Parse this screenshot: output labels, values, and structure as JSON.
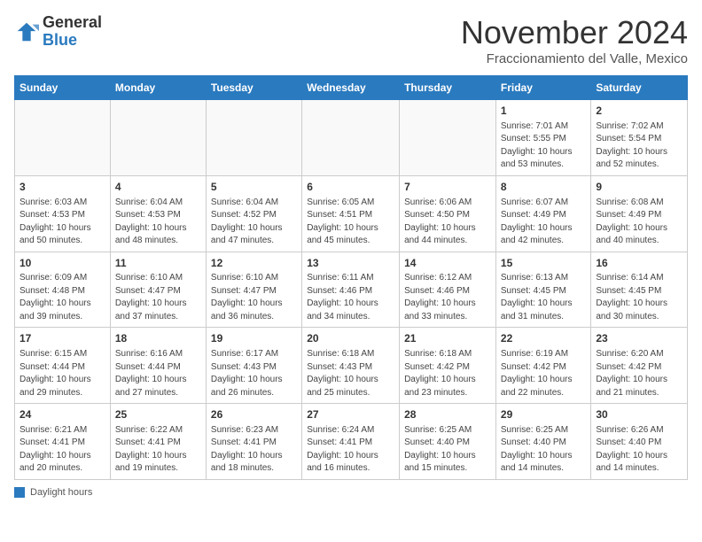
{
  "header": {
    "logo_general": "General",
    "logo_blue": "Blue",
    "month_title": "November 2024",
    "location": "Fraccionamiento del Valle, Mexico"
  },
  "days_of_week": [
    "Sunday",
    "Monday",
    "Tuesday",
    "Wednesday",
    "Thursday",
    "Friday",
    "Saturday"
  ],
  "weeks": [
    [
      {
        "day": "",
        "info": ""
      },
      {
        "day": "",
        "info": ""
      },
      {
        "day": "",
        "info": ""
      },
      {
        "day": "",
        "info": ""
      },
      {
        "day": "",
        "info": ""
      },
      {
        "day": "1",
        "info": "Sunrise: 7:01 AM\nSunset: 5:55 PM\nDaylight: 10 hours\nand 53 minutes."
      },
      {
        "day": "2",
        "info": "Sunrise: 7:02 AM\nSunset: 5:54 PM\nDaylight: 10 hours\nand 52 minutes."
      }
    ],
    [
      {
        "day": "3",
        "info": "Sunrise: 6:03 AM\nSunset: 4:53 PM\nDaylight: 10 hours\nand 50 minutes."
      },
      {
        "day": "4",
        "info": "Sunrise: 6:04 AM\nSunset: 4:53 PM\nDaylight: 10 hours\nand 48 minutes."
      },
      {
        "day": "5",
        "info": "Sunrise: 6:04 AM\nSunset: 4:52 PM\nDaylight: 10 hours\nand 47 minutes."
      },
      {
        "day": "6",
        "info": "Sunrise: 6:05 AM\nSunset: 4:51 PM\nDaylight: 10 hours\nand 45 minutes."
      },
      {
        "day": "7",
        "info": "Sunrise: 6:06 AM\nSunset: 4:50 PM\nDaylight: 10 hours\nand 44 minutes."
      },
      {
        "day": "8",
        "info": "Sunrise: 6:07 AM\nSunset: 4:49 PM\nDaylight: 10 hours\nand 42 minutes."
      },
      {
        "day": "9",
        "info": "Sunrise: 6:08 AM\nSunset: 4:49 PM\nDaylight: 10 hours\nand 40 minutes."
      }
    ],
    [
      {
        "day": "10",
        "info": "Sunrise: 6:09 AM\nSunset: 4:48 PM\nDaylight: 10 hours\nand 39 minutes."
      },
      {
        "day": "11",
        "info": "Sunrise: 6:10 AM\nSunset: 4:47 PM\nDaylight: 10 hours\nand 37 minutes."
      },
      {
        "day": "12",
        "info": "Sunrise: 6:10 AM\nSunset: 4:47 PM\nDaylight: 10 hours\nand 36 minutes."
      },
      {
        "day": "13",
        "info": "Sunrise: 6:11 AM\nSunset: 4:46 PM\nDaylight: 10 hours\nand 34 minutes."
      },
      {
        "day": "14",
        "info": "Sunrise: 6:12 AM\nSunset: 4:46 PM\nDaylight: 10 hours\nand 33 minutes."
      },
      {
        "day": "15",
        "info": "Sunrise: 6:13 AM\nSunset: 4:45 PM\nDaylight: 10 hours\nand 31 minutes."
      },
      {
        "day": "16",
        "info": "Sunrise: 6:14 AM\nSunset: 4:45 PM\nDaylight: 10 hours\nand 30 minutes."
      }
    ],
    [
      {
        "day": "17",
        "info": "Sunrise: 6:15 AM\nSunset: 4:44 PM\nDaylight: 10 hours\nand 29 minutes."
      },
      {
        "day": "18",
        "info": "Sunrise: 6:16 AM\nSunset: 4:44 PM\nDaylight: 10 hours\nand 27 minutes."
      },
      {
        "day": "19",
        "info": "Sunrise: 6:17 AM\nSunset: 4:43 PM\nDaylight: 10 hours\nand 26 minutes."
      },
      {
        "day": "20",
        "info": "Sunrise: 6:18 AM\nSunset: 4:43 PM\nDaylight: 10 hours\nand 25 minutes."
      },
      {
        "day": "21",
        "info": "Sunrise: 6:18 AM\nSunset: 4:42 PM\nDaylight: 10 hours\nand 23 minutes."
      },
      {
        "day": "22",
        "info": "Sunrise: 6:19 AM\nSunset: 4:42 PM\nDaylight: 10 hours\nand 22 minutes."
      },
      {
        "day": "23",
        "info": "Sunrise: 6:20 AM\nSunset: 4:42 PM\nDaylight: 10 hours\nand 21 minutes."
      }
    ],
    [
      {
        "day": "24",
        "info": "Sunrise: 6:21 AM\nSunset: 4:41 PM\nDaylight: 10 hours\nand 20 minutes."
      },
      {
        "day": "25",
        "info": "Sunrise: 6:22 AM\nSunset: 4:41 PM\nDaylight: 10 hours\nand 19 minutes."
      },
      {
        "day": "26",
        "info": "Sunrise: 6:23 AM\nSunset: 4:41 PM\nDaylight: 10 hours\nand 18 minutes."
      },
      {
        "day": "27",
        "info": "Sunrise: 6:24 AM\nSunset: 4:41 PM\nDaylight: 10 hours\nand 16 minutes."
      },
      {
        "day": "28",
        "info": "Sunrise: 6:25 AM\nSunset: 4:40 PM\nDaylight: 10 hours\nand 15 minutes."
      },
      {
        "day": "29",
        "info": "Sunrise: 6:25 AM\nSunset: 4:40 PM\nDaylight: 10 hours\nand 14 minutes."
      },
      {
        "day": "30",
        "info": "Sunrise: 6:26 AM\nSunset: 4:40 PM\nDaylight: 10 hours\nand 14 minutes."
      }
    ]
  ],
  "footer": {
    "label": "Daylight hours"
  }
}
